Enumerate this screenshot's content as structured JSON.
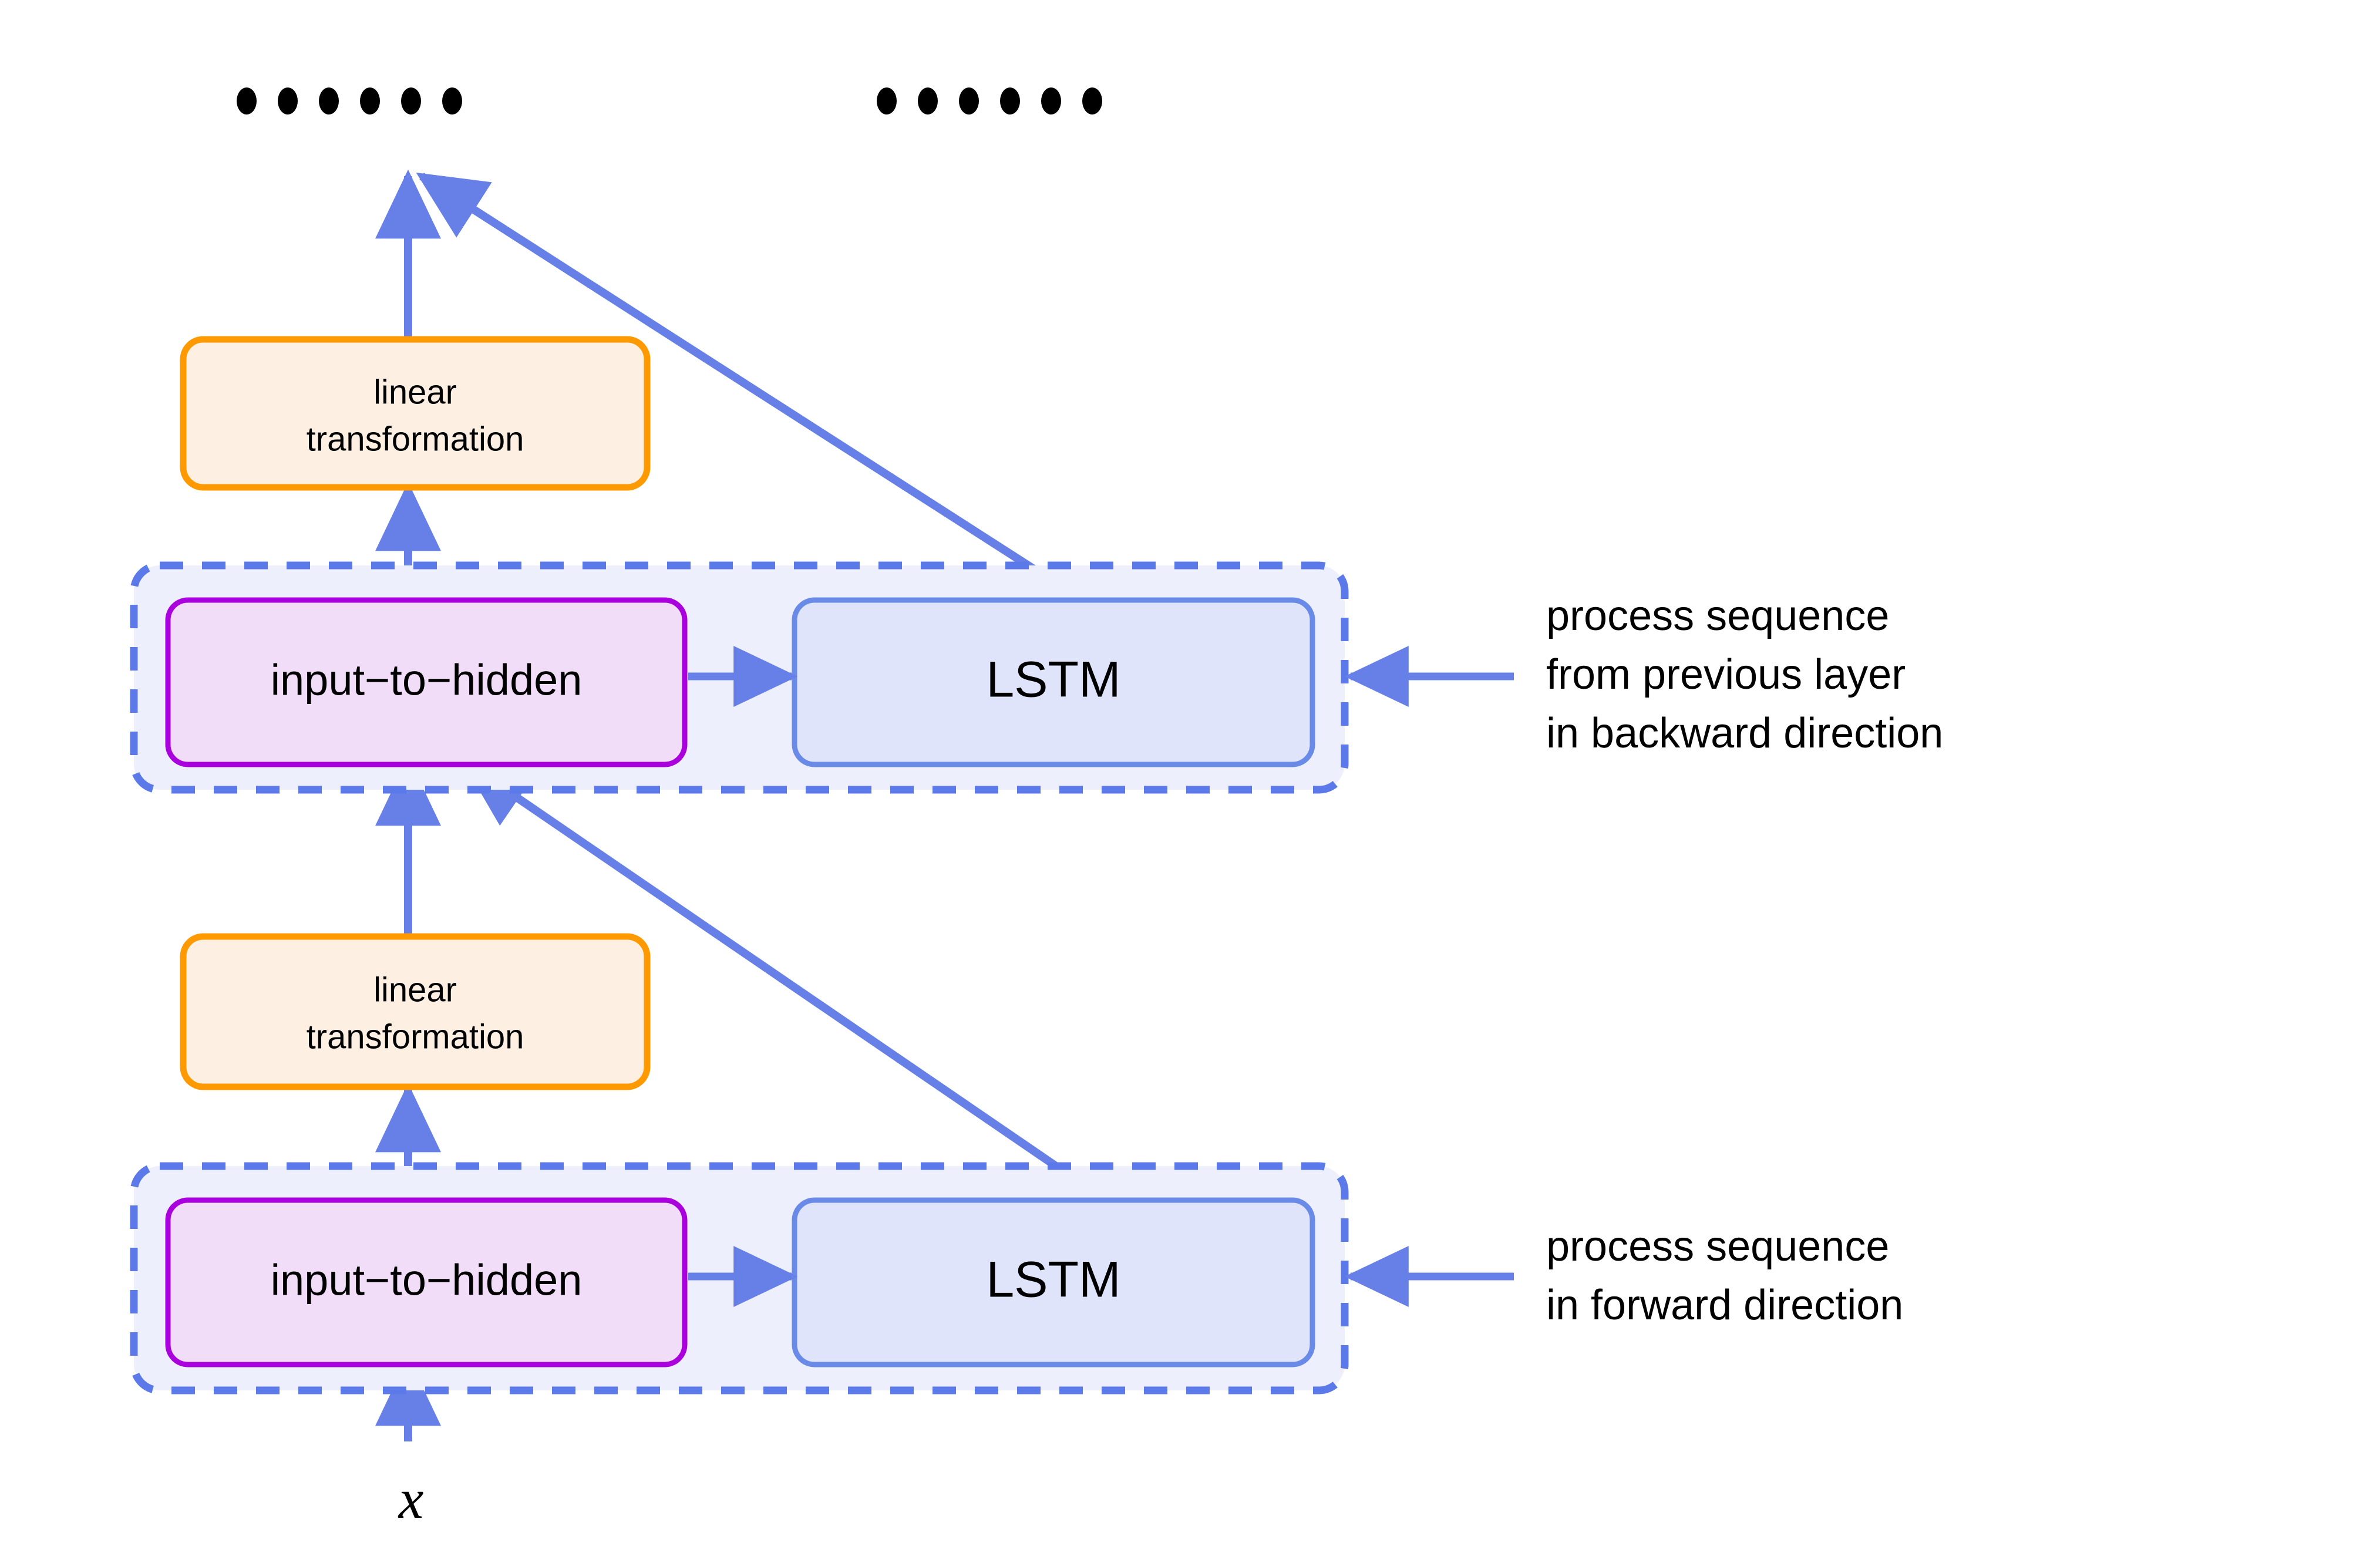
{
  "diagram": {
    "title": "Stacked bidirectional LSTM layer diagram",
    "colors": {
      "arrow_blue": "#6680e8",
      "container_border": "#5b79e8",
      "container_fill": "#edf0fc",
      "lstm_border": "#6a8ae8",
      "lstm_fill": "#dfe4fa",
      "i2h_border": "#aa00dd",
      "i2h_fill": "#f2ddf9",
      "linear_border": "#ff9900",
      "linear_fill": "#fdf0e3",
      "text": "#000000",
      "background": "#ffffff"
    },
    "layers": [
      {
        "id": "backward-layer",
        "container_label": "process sequence from previous layer in backward direction",
        "linear_label_line1": "linear",
        "linear_label_line2": "transformation",
        "input_to_hidden_label": "input−to−hidden",
        "lstm_label": "LSTM",
        "annotation_lines": [
          "process sequence",
          "from previous layer",
          "in backward direction"
        ]
      },
      {
        "id": "forward-layer",
        "container_label": "process sequence in forward direction",
        "linear_label_line1": "linear",
        "linear_label_line2": "transformation",
        "input_to_hidden_label": "input−to−hidden",
        "lstm_label": "LSTM",
        "annotation_lines": [
          "process sequence",
          "in forward direction"
        ]
      }
    ],
    "input": {
      "symbol": "x"
    },
    "ellipsis": {
      "group_left_count": 6,
      "group_right_count": 6
    }
  }
}
